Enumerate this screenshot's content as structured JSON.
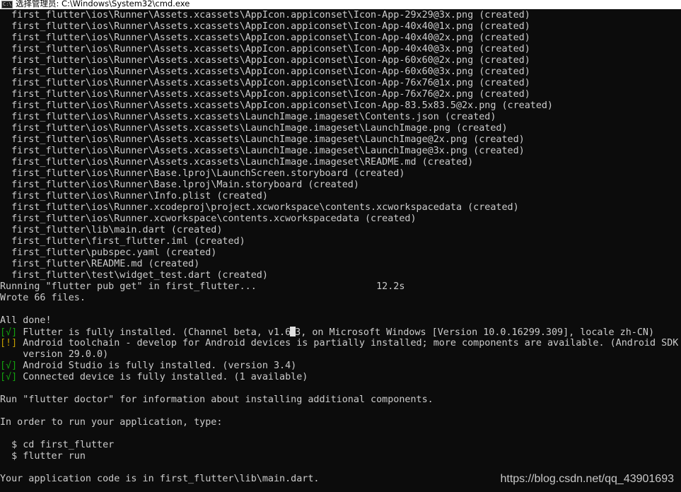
{
  "window": {
    "title": "选择管理员: C:\\Windows\\System32\\cmd.exe",
    "icon": "cmd-icon",
    "icon_text": "C:\\"
  },
  "colors": {
    "background": "#0c0c0c",
    "text": "#cccccc",
    "ok_mark": "#13a10e",
    "warn_mark": "#c19c00"
  },
  "console": {
    "lines": [
      "  first_flutter\\ios\\Runner\\Assets.xcassets\\AppIcon.appiconset\\Icon-App-29x29@3x.png (created)",
      "  first_flutter\\ios\\Runner\\Assets.xcassets\\AppIcon.appiconset\\Icon-App-40x40@1x.png (created)",
      "  first_flutter\\ios\\Runner\\Assets.xcassets\\AppIcon.appiconset\\Icon-App-40x40@2x.png (created)",
      "  first_flutter\\ios\\Runner\\Assets.xcassets\\AppIcon.appiconset\\Icon-App-40x40@3x.png (created)",
      "  first_flutter\\ios\\Runner\\Assets.xcassets\\AppIcon.appiconset\\Icon-App-60x60@2x.png (created)",
      "  first_flutter\\ios\\Runner\\Assets.xcassets\\AppIcon.appiconset\\Icon-App-60x60@3x.png (created)",
      "  first_flutter\\ios\\Runner\\Assets.xcassets\\AppIcon.appiconset\\Icon-App-76x76@1x.png (created)",
      "  first_flutter\\ios\\Runner\\Assets.xcassets\\AppIcon.appiconset\\Icon-App-76x76@2x.png (created)",
      "  first_flutter\\ios\\Runner\\Assets.xcassets\\AppIcon.appiconset\\Icon-App-83.5x83.5@2x.png (created)",
      "  first_flutter\\ios\\Runner\\Assets.xcassets\\LaunchImage.imageset\\Contents.json (created)",
      "  first_flutter\\ios\\Runner\\Assets.xcassets\\LaunchImage.imageset\\LaunchImage.png (created)",
      "  first_flutter\\ios\\Runner\\Assets.xcassets\\LaunchImage.imageset\\LaunchImage@2x.png (created)",
      "  first_flutter\\ios\\Runner\\Assets.xcassets\\LaunchImage.imageset\\LaunchImage@3x.png (created)",
      "  first_flutter\\ios\\Runner\\Assets.xcassets\\LaunchImage.imageset\\README.md (created)",
      "  first_flutter\\ios\\Runner\\Base.lproj\\LaunchScreen.storyboard (created)",
      "  first_flutter\\ios\\Runner\\Base.lproj\\Main.storyboard (created)",
      "  first_flutter\\ios\\Runner\\Info.plist (created)",
      "  first_flutter\\ios\\Runner.xcodeproj\\project.xcworkspace\\contents.xcworkspacedata (created)",
      "  first_flutter\\ios\\Runner.xcworkspace\\contents.xcworkspacedata (created)",
      "  first_flutter\\lib\\main.dart (created)",
      "  first_flutter\\first_flutter.iml (created)",
      "  first_flutter\\pubspec.yaml (created)",
      "  first_flutter\\README.md (created)",
      "  first_flutter\\test\\widget_test.dart (created)",
      "Running \"flutter pub get\" in first_flutter...                     12.2s",
      "Wrote 66 files.",
      "",
      "All done!"
    ],
    "doctor": [
      {
        "mark": "[√]",
        "status": "ok",
        "text": " Flutter is fully installed. (Channel beta, v1.6",
        "cursor_char": ".",
        "text_after": "3, on Microsoft Windows [Version 10.0.16299.309], locale zh-CN)"
      },
      {
        "mark": "[!]",
        "status": "warn",
        "text": " Android toolchain - develop for Android devices is partially installed; more components are available. (Android SDK"
      },
      {
        "mark": "",
        "status": "plain",
        "text": "    version 29.0.0)"
      },
      {
        "mark": "[√]",
        "status": "ok",
        "text": " Android Studio is fully installed. (version 3.4)"
      },
      {
        "mark": "[√]",
        "status": "ok",
        "text": " Connected device is fully installed. (1 available)"
      }
    ],
    "after_lines": [
      "",
      "Run \"flutter doctor\" for information about installing additional components.",
      "",
      "In order to run your application, type:",
      "",
      "  $ cd first_flutter",
      "  $ flutter run",
      "",
      "Your application code is in first_flutter\\lib\\main.dart."
    ]
  },
  "watermark": "https://blog.csdn.net/qq_43901693"
}
